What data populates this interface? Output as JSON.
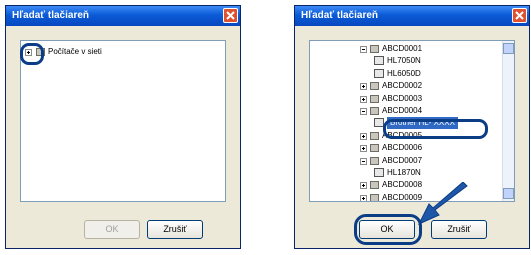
{
  "left_dialog": {
    "title": "Hľadať tlačiareň",
    "tree": {
      "root_label": "Počítače v sieti"
    },
    "ok_label": "OK",
    "cancel_label": "Zrušiť"
  },
  "right_dialog": {
    "title": "Hľadať tlačiareň",
    "tree_items": [
      {
        "label": "ABCD0001",
        "kind": "computer",
        "expander": "minus"
      },
      {
        "label": "HL7050N",
        "kind": "printer"
      },
      {
        "label": "HL6050D",
        "kind": "printer"
      },
      {
        "label": "ABCD0002",
        "kind": "computer",
        "expander": "plus"
      },
      {
        "label": "ABCD0003",
        "kind": "computer",
        "expander": "plus"
      },
      {
        "label": "ABCD0004",
        "kind": "computer",
        "expander": "minus"
      },
      {
        "label": "Brother HL- XXXX",
        "kind": "printer",
        "selected": true
      },
      {
        "label": "ABCD0005",
        "kind": "computer",
        "expander": "plus"
      },
      {
        "label": "ABCD0006",
        "kind": "computer",
        "expander": "plus"
      },
      {
        "label": "ABCD0007",
        "kind": "computer",
        "expander": "minus"
      },
      {
        "label": "HL1870N",
        "kind": "printer"
      },
      {
        "label": "ABCD0008",
        "kind": "computer",
        "expander": "plus"
      },
      {
        "label": "ABCD0009",
        "kind": "computer",
        "expander": "plus"
      }
    ],
    "ok_label": "OK",
    "cancel_label": "Zrušiť"
  },
  "colors": {
    "titlebar": "#0a5bd6",
    "callout": "#0a3d86",
    "close": "#e0512f",
    "selection": "#316ac5"
  }
}
